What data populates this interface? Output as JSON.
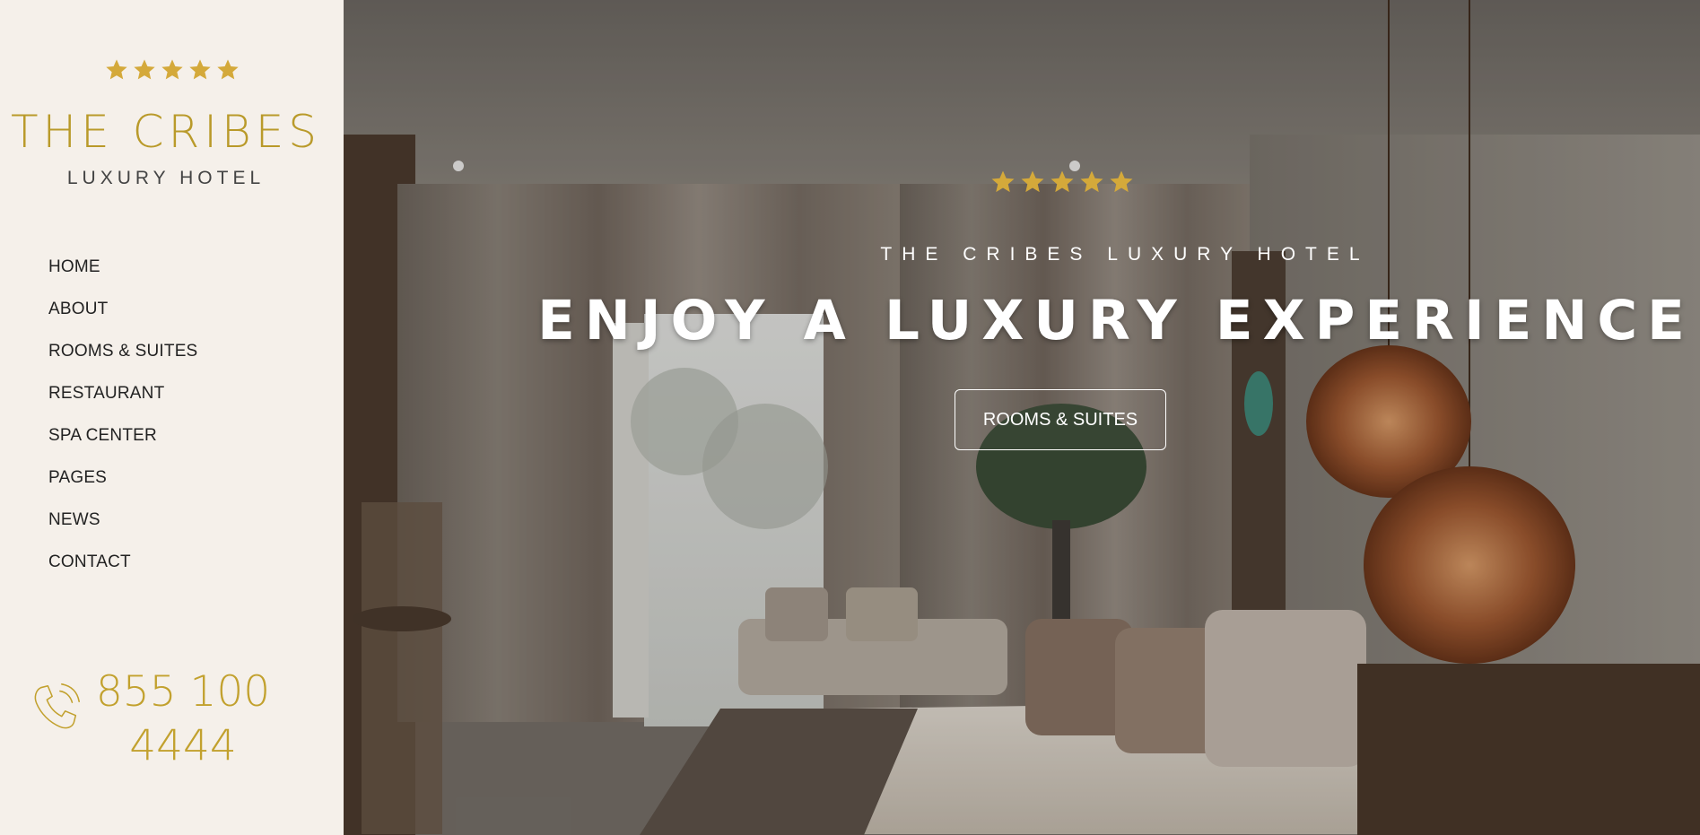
{
  "sidebar": {
    "rating_stars": 5,
    "brand_name": "THE CRIBES",
    "brand_sub": "LUXURY HOTEL",
    "nav": [
      "HOME",
      "ABOUT",
      "ROOMS & SUITES",
      "RESTAURANT",
      "SPA CENTER",
      "PAGES",
      "NEWS",
      "CONTACT"
    ],
    "phone_line1": "855 100",
    "phone_line2": "4444",
    "phone_icon": "phone-icon"
  },
  "hero": {
    "rating_stars": 5,
    "eyebrow": "THE CRIBES LUXURY HOTEL",
    "title": "ENJOY A LUXURY EXPERIENCE",
    "button_label": "ROOMS & SUITES",
    "background": "hotel bedroom photo"
  },
  "colors": {
    "sidebar_bg": "#f5f0ea",
    "gold": "#c2a12e",
    "star": "#d4a93a",
    "text_dark": "#222222"
  }
}
